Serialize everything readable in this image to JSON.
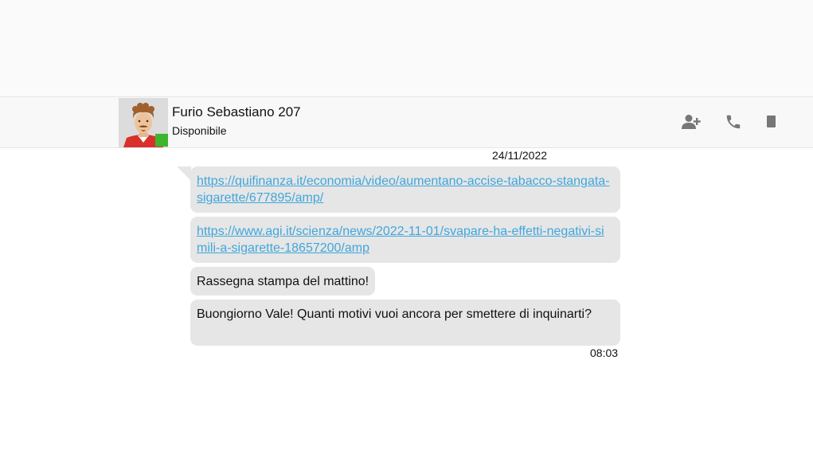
{
  "contact": {
    "name": "Furio Sebastiano 207",
    "status": "Disponibile",
    "presence_color": "#3db52d"
  },
  "header_actions": [
    {
      "icon": "add-user-icon"
    },
    {
      "icon": "phone-icon"
    },
    {
      "icon": "mobile-phone-icon"
    }
  ],
  "conversation": {
    "date": "24/11/2022",
    "messages": [
      {
        "type": "link",
        "text": "https://quifinanza.it/economia/video/aumentano-accise-tabacco-stangata-sigarette/677895/amp/"
      },
      {
        "type": "link",
        "text": "https://www.agi.it/scienza/news/2022-11-01/svapare-ha-effetti-negativi-simili-a-sigarette-18657200/amp"
      },
      {
        "type": "text",
        "text": "Rassegna stampa del mattino!"
      },
      {
        "type": "text",
        "text": "Buongiorno Vale! Quanti motivi vuoi ancora per smettere di inquinarti?"
      }
    ],
    "time": "08:03"
  },
  "colors": {
    "bubble_bg": "#e6e6e6",
    "link": "#3fa7dc",
    "icon": "#777777"
  }
}
